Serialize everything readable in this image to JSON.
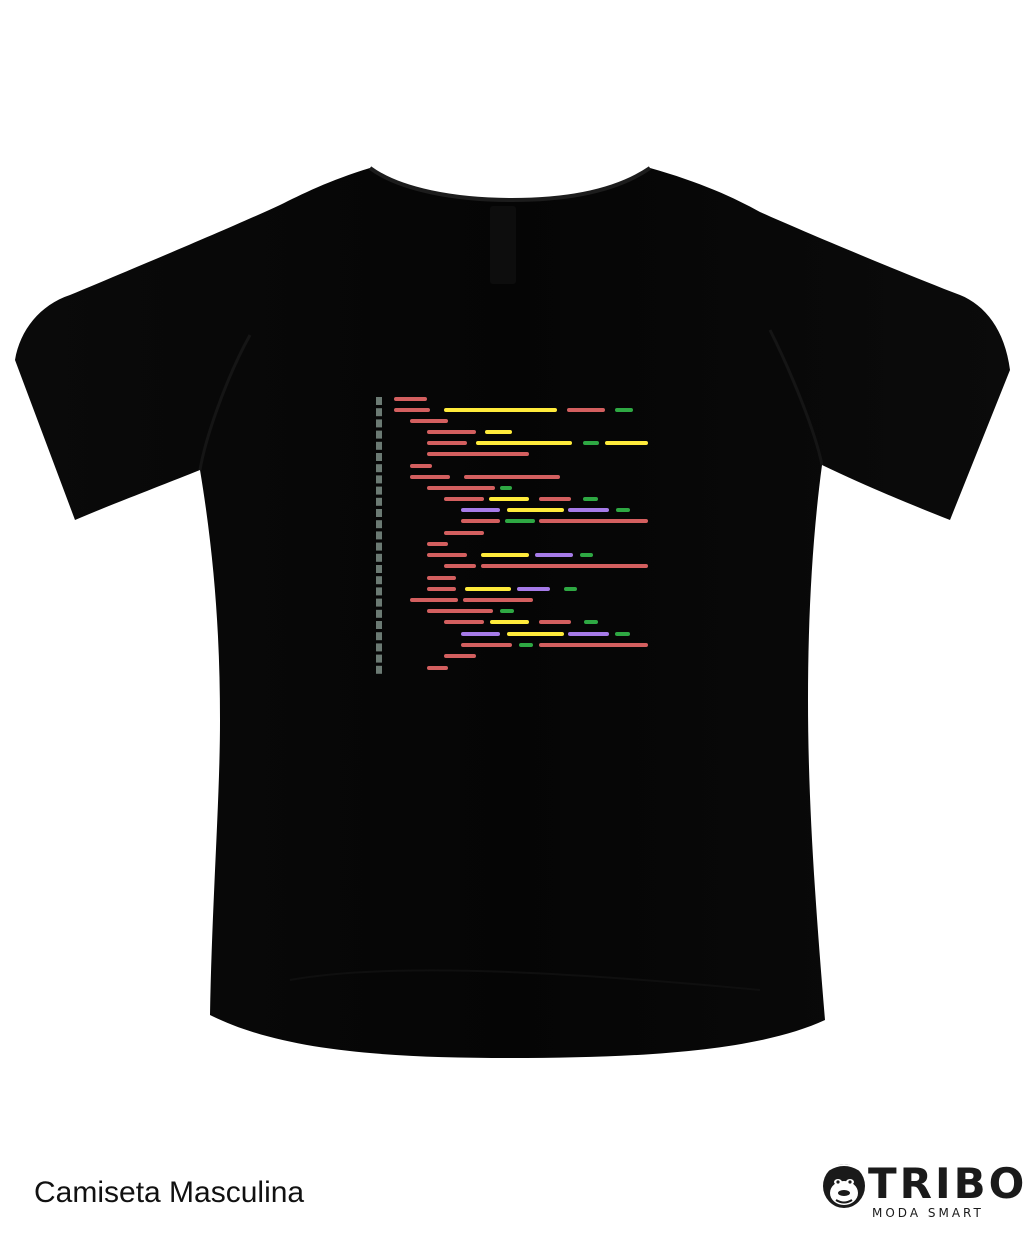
{
  "product": {
    "caption": "Camiseta Masculina",
    "garment_color": "#050505",
    "print_palette": {
      "red": "#d35f5f",
      "yellow": "#ffeb3b",
      "green": "#2ea843",
      "purple": "#a67be8",
      "gutter": "#6b7a73"
    }
  },
  "brand": {
    "name": "TRIBO",
    "tagline": "MODA SMART",
    "icon": "gorilla-head-icon"
  }
}
